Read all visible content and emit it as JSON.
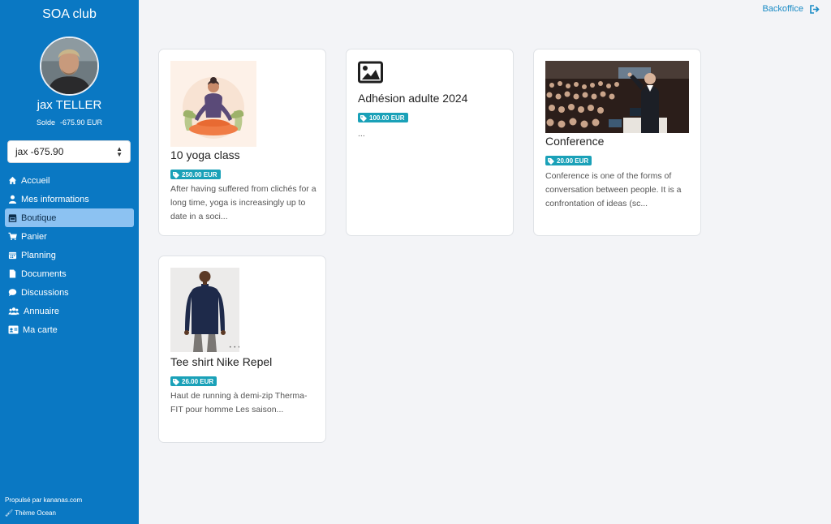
{
  "sidebar": {
    "club_name": "SOA club",
    "user_name": "jax TELLER",
    "balance_label": "Solde",
    "balance_value": "-675.90 EUR",
    "account_select_value": "jax -675.90",
    "nav": [
      {
        "label": "Accueil",
        "icon": "home-icon"
      },
      {
        "label": "Mes informations",
        "icon": "user-icon"
      },
      {
        "label": "Boutique",
        "icon": "store-icon",
        "active": true
      },
      {
        "label": "Panier",
        "icon": "cart-icon"
      },
      {
        "label": "Planning",
        "icon": "calendar-icon"
      },
      {
        "label": "Documents",
        "icon": "document-icon"
      },
      {
        "label": "Discussions",
        "icon": "comment-icon"
      },
      {
        "label": "Annuaire",
        "icon": "users-icon"
      },
      {
        "label": "Ma carte",
        "icon": "id-card-icon"
      }
    ],
    "footer_powered": "Propulsé par kananas.com",
    "footer_theme": "Thème Ocean"
  },
  "header": {
    "backoffice_label": "Backoffice"
  },
  "products": [
    {
      "title": "10 yoga class",
      "price": "250.00 EUR",
      "description": "After having suffered from clichés for a long time, yoga is increasingly up to date in a soci..."
    },
    {
      "title": "Adhésion adulte 2024",
      "price": "100.00 EUR",
      "description": "..."
    },
    {
      "title": "Conference",
      "price": "20.00 EUR",
      "description": "Conference is one of the forms of conversation between people. It is a confrontation of ideas (sc..."
    },
    {
      "title": "Tee shirt Nike Repel",
      "price": "26.00 EUR",
      "description": "Haut de running à demi-zip Therma-FIT pour homme Les saison..."
    }
  ],
  "colors": {
    "sidebar_bg": "#0a78c3",
    "active_nav_bg": "#8cc2f2",
    "price_badge": "#1aa1b8",
    "link": "#1a8bc5",
    "page_bg": "#f3f4f7"
  }
}
